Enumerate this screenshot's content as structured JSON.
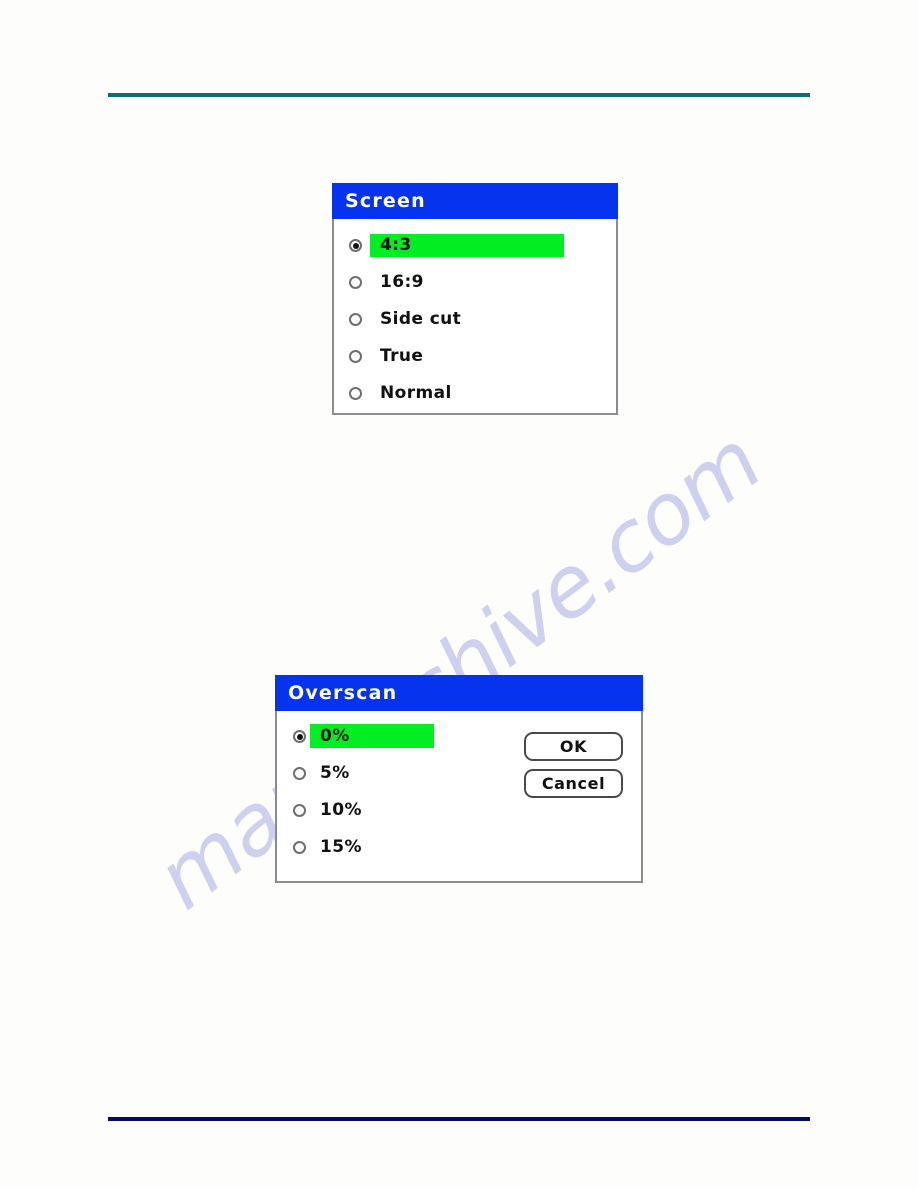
{
  "page": {
    "background_color": "#fdfdfb",
    "header_rule_color": "#0d6e72",
    "footer_rule_color": "#070a62",
    "watermark_text": "manualshive.com"
  },
  "colors": {
    "title_bar_blue": "#0633ee",
    "highlight_green": "#00ee22",
    "dialog_border_gray": "#8c8c8c",
    "text_black": "#111111"
  },
  "screen_dialog": {
    "title": "Screen",
    "options": [
      {
        "label": "4:3",
        "selected": true,
        "highlighted": true
      },
      {
        "label": "16:9",
        "selected": false,
        "highlighted": false
      },
      {
        "label": "Side cut",
        "selected": false,
        "highlighted": false
      },
      {
        "label": "True",
        "selected": false,
        "highlighted": false
      },
      {
        "label": "Normal",
        "selected": false,
        "highlighted": false
      }
    ]
  },
  "overscan_dialog": {
    "title": "Overscan",
    "options": [
      {
        "label": "0%",
        "selected": true,
        "highlighted": true
      },
      {
        "label": "5%",
        "selected": false,
        "highlighted": false
      },
      {
        "label": "10%",
        "selected": false,
        "highlighted": false
      },
      {
        "label": "15%",
        "selected": false,
        "highlighted": false
      }
    ],
    "buttons": {
      "ok": "OK",
      "cancel": "Cancel"
    }
  }
}
